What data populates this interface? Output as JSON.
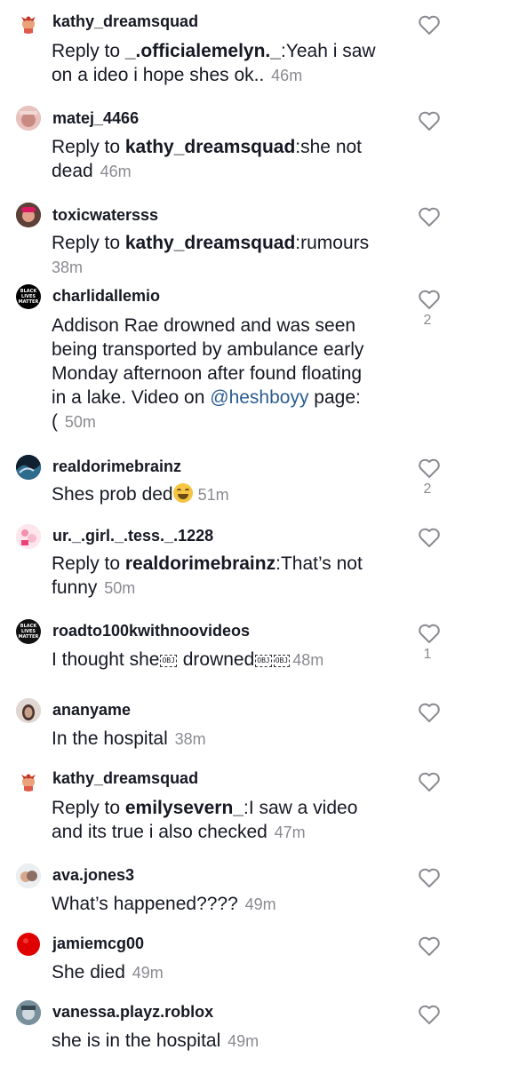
{
  "comments": [
    {
      "username": "kathy_dreamsquad",
      "reply_prefix": "Reply to ",
      "reply_to": "_.officialemelyn._",
      "text_lines": [
        ":Yeah i saw",
        "on a ideo i hope shes ok.. "
      ],
      "time": "46m",
      "avatar": "bow-avatar"
    },
    {
      "username": "matej_4466",
      "reply_prefix": "Reply to ",
      "reply_to": "kathy_dreamsquad",
      "text_lines": [
        ":she not",
        "dead "
      ],
      "time": "46m"
    },
    {
      "username": "toxicwatersss",
      "reply_prefix": "Reply to ",
      "reply_to": "kathy_dreamsquad",
      "text_lines": [
        ":rumours",
        ""
      ],
      "time": "38m"
    },
    {
      "username": "charlidallemio",
      "text_lines": [
        "Addison Rae drowned and was seen",
        "being transported by ambulance early",
        "Monday afternoon after found floating",
        "in a lake. Video on "
      ],
      "link": "@heshboyy",
      "after_link": " page:",
      "last_line": "( ",
      "time": "50m",
      "likes": "2",
      "avatar_text": [
        "BLACK",
        "LIVES",
        "MATTER"
      ]
    },
    {
      "username": "realdorimebrainz",
      "text": "Shes prob ded",
      "emoji": "crying-laughing-cat-emoji",
      "time": "51m",
      "likes": "2"
    },
    {
      "username": "ur._.girl._.tess._.1228",
      "reply_prefix": "Reply to ",
      "reply_to": "realdorimebrainz",
      "text_lines": [
        ":That’s not",
        "funny "
      ],
      "time": "50m"
    },
    {
      "username": "roadto100kwithnoovideos",
      "text_parts": [
        "I thought she",
        " drowned"
      ],
      "obj": "OBJ",
      "time": "48m",
      "likes": "1",
      "avatar_text": [
        "BLACK",
        "LIVES",
        "MATTER"
      ]
    },
    {
      "username": "ananyame",
      "text": "In the hospital ",
      "time": "38m"
    },
    {
      "username": "kathy_dreamsquad",
      "reply_prefix": "Reply to ",
      "reply_to": "emilysevern_",
      "text_lines": [
        ":I saw a video",
        "and its true i also checked "
      ],
      "time": "47m"
    },
    {
      "username": "ava.jones3",
      "text": "What’s happened???? ",
      "time": "49m"
    },
    {
      "username": "jamiemcg00",
      "text": "She died ",
      "time": "49m"
    },
    {
      "username": "vanessa.playz.roblox",
      "text": "she is in the hospital ",
      "time": "49m"
    }
  ],
  "colors": {
    "text": "#161823",
    "muted": "#8a8b91",
    "link": "#2b5d91"
  },
  "icons": {
    "like": "heart-outline-icon"
  }
}
